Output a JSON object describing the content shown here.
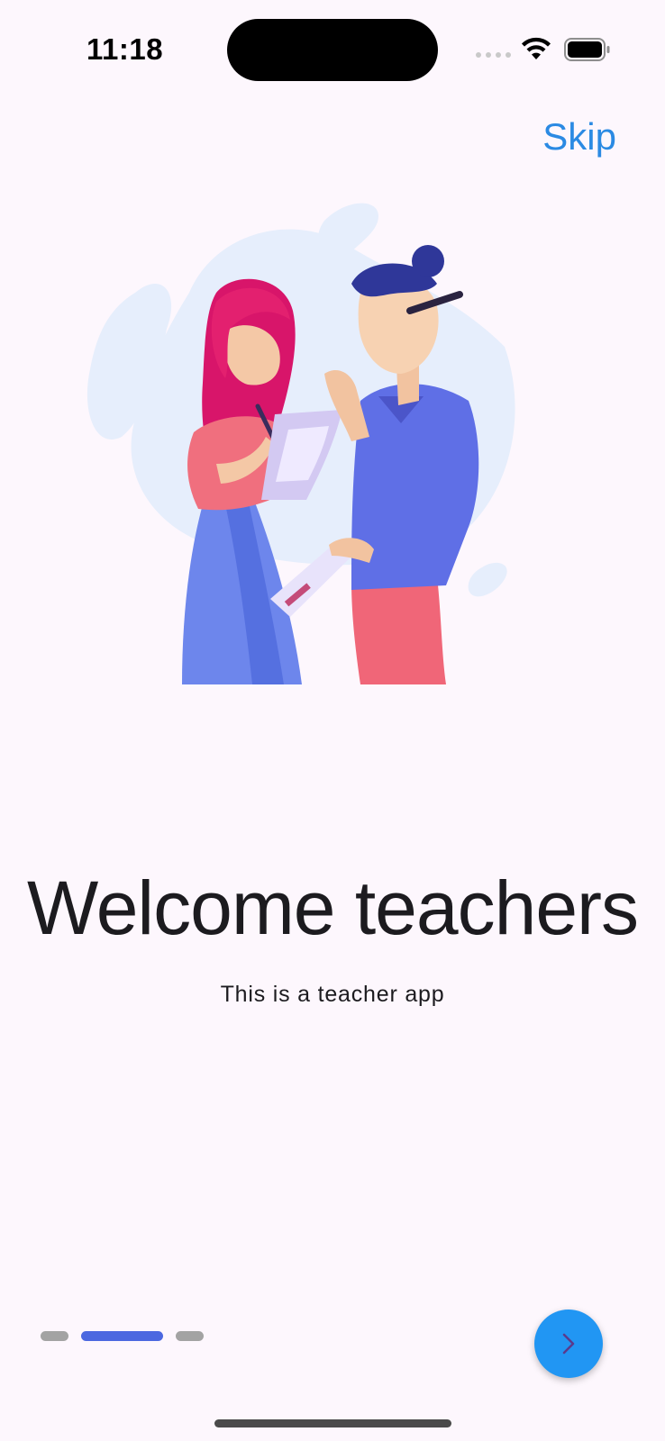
{
  "status_bar": {
    "time": "11:18"
  },
  "header": {
    "skip_label": "Skip"
  },
  "onboarding": {
    "title": "Welcome teachers",
    "subtitle": "This is a teacher app",
    "illustration_icon": "teachers-illustration",
    "page_count": 3,
    "active_page": 2
  },
  "next_button": {
    "icon": "chevron-right-icon"
  },
  "colors": {
    "background": "#fdf7fd",
    "accent": "#2196f3",
    "skip": "#2b8ae3",
    "indicator_active": "#4b68e0",
    "indicator_inactive": "#a3a3a3"
  }
}
